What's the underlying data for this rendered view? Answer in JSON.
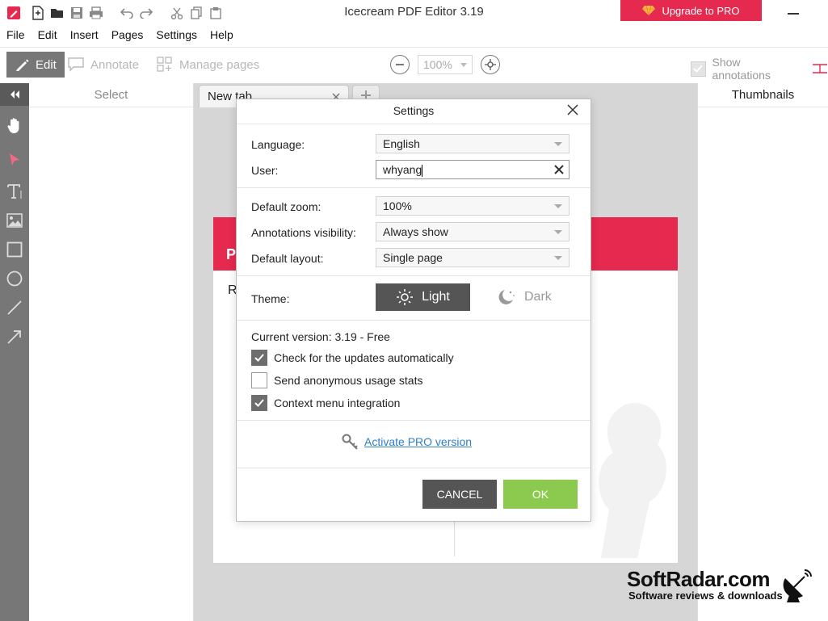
{
  "app": {
    "title": "Icecream PDF Editor 3.19",
    "upgrade_label": "Upgrade to PRO",
    "brand_color": "#e5294f"
  },
  "quick_access": [
    "pencil-logo-icon",
    "new-file-icon",
    "open-folder-icon",
    "save-icon",
    "print-icon",
    "undo-icon",
    "redo-icon",
    "cut-icon",
    "copy-icon",
    "paste-icon"
  ],
  "menu": [
    "File",
    "Edit",
    "Insert",
    "Pages",
    "Settings",
    "Help"
  ],
  "toolbar": {
    "edit_label": "Edit",
    "annotate_label": "Annotate",
    "manage_pages_label": "Manage pages",
    "zoom_value": "100%",
    "show_annotations_label": "Show annotations"
  },
  "left_tools": [
    "hand-icon",
    "select-arrow-icon",
    "text-icon",
    "image-icon",
    "rectangle-icon",
    "ellipse-icon",
    "line-icon",
    "arrow-icon"
  ],
  "panels": {
    "select_title": "Select",
    "thumbnails_title": "Thumbnails"
  },
  "tabs": [
    {
      "label": "New tab"
    }
  ],
  "document": {
    "band_text": "P",
    "body_text": "R"
  },
  "dialog": {
    "title": "Settings",
    "language_label": "Language:",
    "language_value": "English",
    "user_label": "User:",
    "user_value": "whyang",
    "default_zoom_label": "Default zoom:",
    "default_zoom_value": "100%",
    "annotations_visibility_label": "Annotations visibility:",
    "annotations_visibility_value": "Always show",
    "default_layout_label": "Default layout:",
    "default_layout_value": "Single page",
    "theme_label": "Theme:",
    "theme_light": "Light",
    "theme_dark": "Dark",
    "current_version": "Current version: 3.19 - Free",
    "check_updates_label": "Check for the updates automatically",
    "check_updates_checked": true,
    "usage_stats_label": "Send anonymous usage stats",
    "usage_stats_checked": false,
    "context_menu_label": "Context menu integration",
    "context_menu_checked": true,
    "activate_label": "Activate PRO version",
    "cancel_label": "CANCEL",
    "ok_label": "OK",
    "ok_color": "#8cc94f"
  },
  "watermark": {
    "title": "SoftRadar.com",
    "subtitle": "Software reviews & downloads"
  }
}
